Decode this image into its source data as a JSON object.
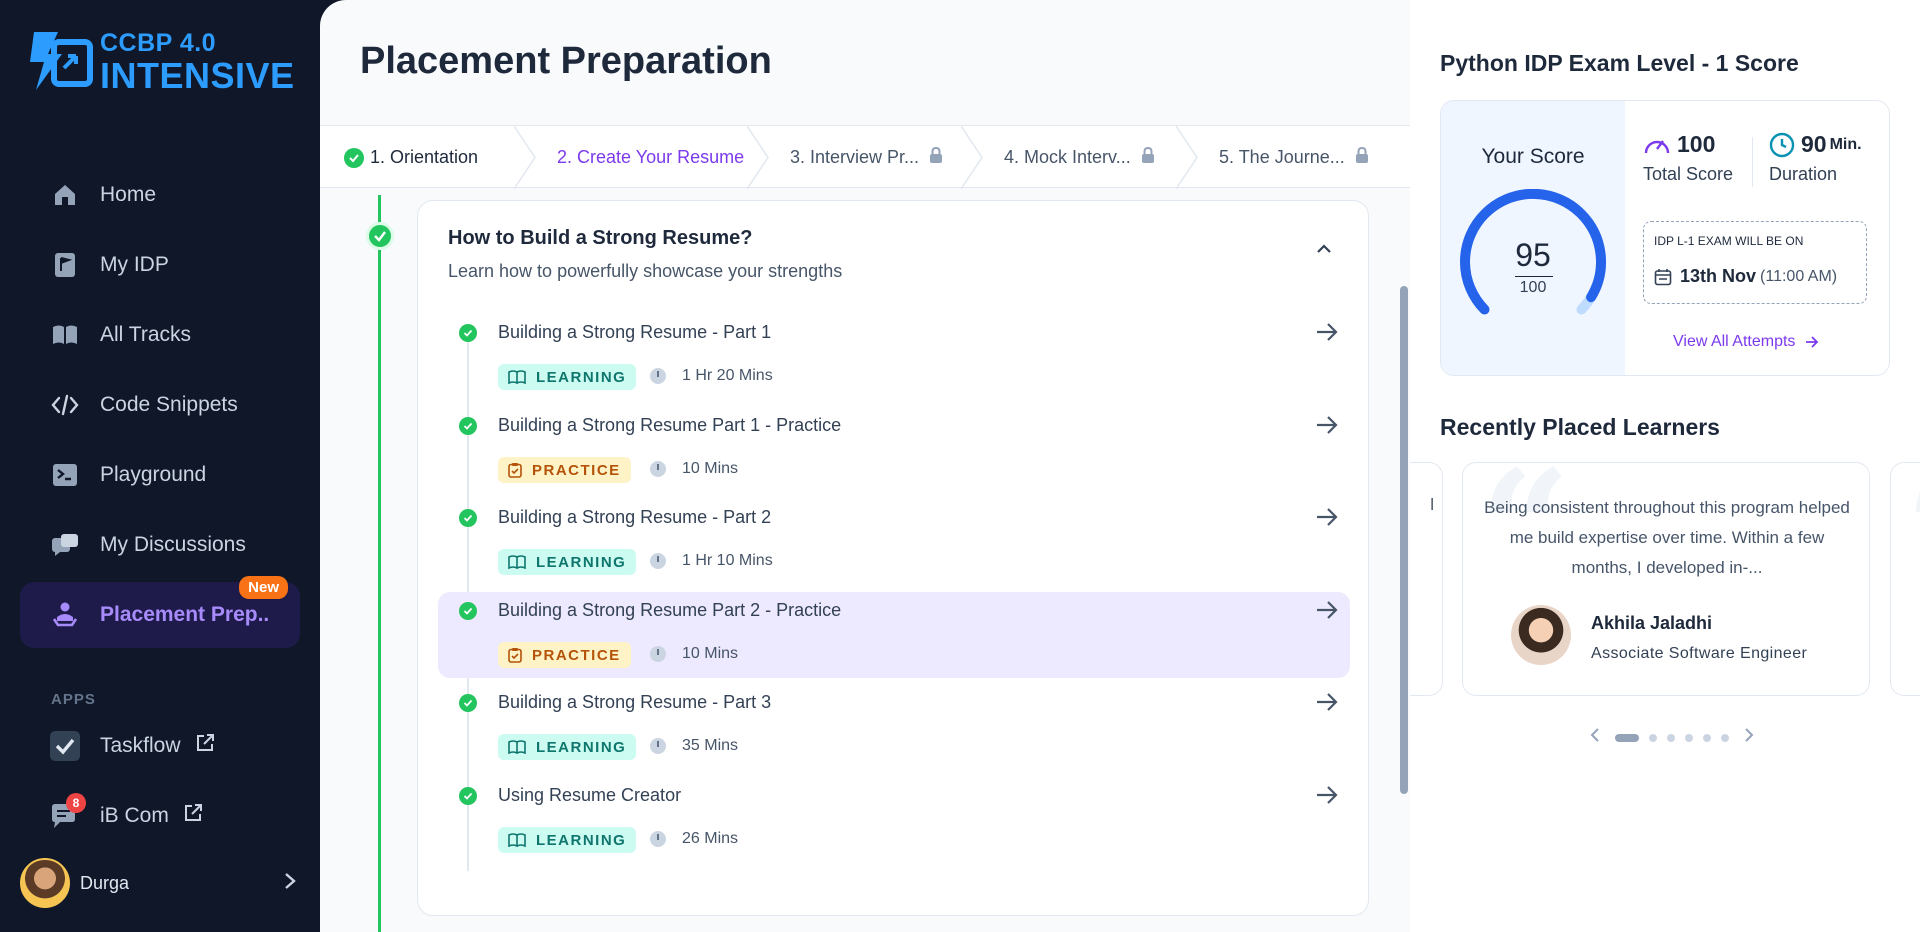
{
  "brand": {
    "line1": "CCBP 4.0",
    "line2": "INTENSIVE",
    "color": "#2d9cff"
  },
  "sidebar": {
    "items": [
      {
        "label": "Home",
        "icon": "home-icon"
      },
      {
        "label": "My IDP",
        "icon": "flag-doc-icon"
      },
      {
        "label": "All Tracks",
        "icon": "book-icon"
      },
      {
        "label": "Code Snippets",
        "icon": "code-icon"
      },
      {
        "label": "Playground",
        "icon": "terminal-icon"
      },
      {
        "label": "My Discussions",
        "icon": "discussion-icon"
      },
      {
        "label": "Placement Prep..",
        "icon": "placement-icon",
        "active": true,
        "badge": "New"
      }
    ],
    "apps_label": "APPS",
    "apps": [
      {
        "label": "Taskflow",
        "icon": "taskflow-icon"
      },
      {
        "label": "iB Com",
        "icon": "chat-icon",
        "badge": "8"
      }
    ],
    "user": {
      "name": "Durga"
    }
  },
  "main": {
    "title": "Placement Preparation",
    "steps": [
      {
        "label": "1. Orientation",
        "state": "done"
      },
      {
        "label": "2. Create Your Resume",
        "state": "current"
      },
      {
        "label": "3. Interview Pr...",
        "state": "locked"
      },
      {
        "label": "4. Mock Interv...",
        "state": "locked"
      },
      {
        "label": "5. The Journe...",
        "state": "locked"
      }
    ],
    "section": {
      "title": "How to Build a Strong Resume?",
      "subtitle": "Learn how to powerfully showcase your strengths",
      "items": [
        {
          "title": "Building a Strong Resume - Part 1",
          "tag": "LEARNING",
          "duration": "1 Hr 20 Mins"
        },
        {
          "title": "Building a Strong Resume Part 1 - Practice",
          "tag": "PRACTICE",
          "duration": "10 Mins"
        },
        {
          "title": "Building a Strong Resume - Part 2",
          "tag": "LEARNING",
          "duration": "1 Hr 10 Mins"
        },
        {
          "title": "Building a Strong Resume Part 2 - Practice",
          "tag": "PRACTICE",
          "duration": "10 Mins",
          "active": true
        },
        {
          "title": "Building a Strong Resume - Part 3",
          "tag": "LEARNING",
          "duration": "35 Mins"
        },
        {
          "title": "Using Resume Creator",
          "tag": "LEARNING",
          "duration": "26 Mins"
        }
      ]
    }
  },
  "score": {
    "title": "Python IDP Exam Level - 1 Score",
    "your_score_label": "Your Score",
    "value": "95",
    "max": "100",
    "total_score": "100",
    "total_score_label": "Total Score",
    "duration": "90",
    "duration_unit": "Min.",
    "duration_label": "Duration",
    "exam_label": "IDP L-1 EXAM WILL BE ON",
    "exam_date": "13th Nov",
    "exam_time": "(11:00 AM)",
    "view_all": "View All Attempts"
  },
  "placed": {
    "title": "Recently Placed Learners",
    "left_peek": "l",
    "testimonial": "Being consistent throughout this program helped me build expertise over time. Within a few months, I developed in-...",
    "name": "Akhila Jaladhi",
    "role": "Associate Software Engineer",
    "dots": 6,
    "active_dot": 0
  },
  "colors": {
    "accent": "#7c3aed",
    "success": "#22c55e",
    "sidebar_bg": "#0f1729"
  }
}
